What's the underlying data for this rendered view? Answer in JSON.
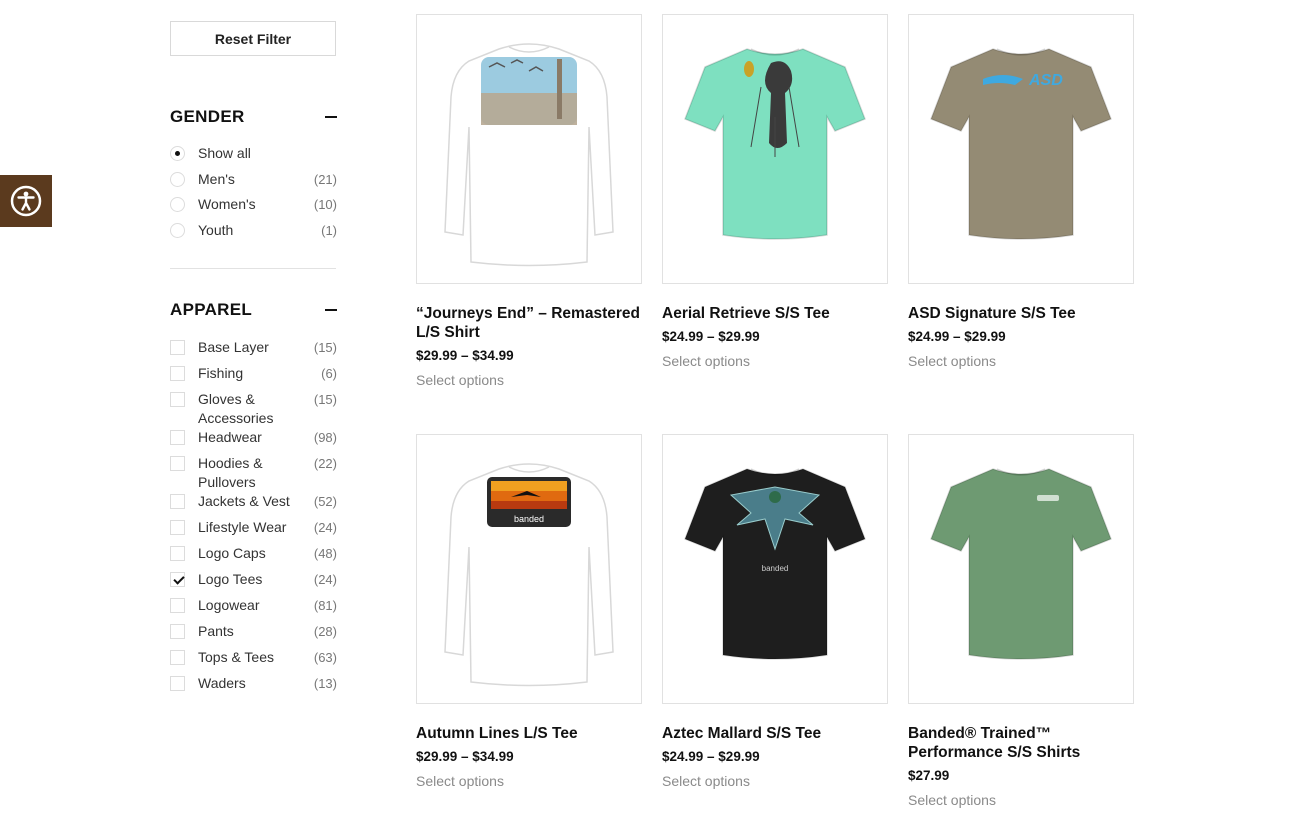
{
  "sidebar": {
    "reset_label": "Reset Filter",
    "gender": {
      "title": "GENDER",
      "options": [
        {
          "label": "Show all",
          "count": "",
          "checked": true
        },
        {
          "label": "Men's",
          "count": "(21)",
          "checked": false
        },
        {
          "label": "Women's",
          "count": "(10)",
          "checked": false
        },
        {
          "label": "Youth",
          "count": "(1)",
          "checked": false
        }
      ]
    },
    "apparel": {
      "title": "APPAREL",
      "options": [
        {
          "label": "Base Layer",
          "count": "(15)",
          "checked": false
        },
        {
          "label": "Fishing",
          "count": "(6)",
          "checked": false
        },
        {
          "label": "Gloves & Accessories",
          "count": "(15)",
          "checked": false
        },
        {
          "label": "Headwear",
          "count": "(98)",
          "checked": false
        },
        {
          "label": "Hoodies & Pullovers",
          "count": "(22)",
          "checked": false
        },
        {
          "label": "Jackets & Vest",
          "count": "(52)",
          "checked": false
        },
        {
          "label": "Lifestyle Wear",
          "count": "(24)",
          "checked": false
        },
        {
          "label": "Logo Caps",
          "count": "(48)",
          "checked": false
        },
        {
          "label": "Logo Tees",
          "count": "(24)",
          "checked": true
        },
        {
          "label": "Logowear",
          "count": "(81)",
          "checked": false
        },
        {
          "label": "Pants",
          "count": "(28)",
          "checked": false
        },
        {
          "label": "Tops & Tees",
          "count": "(63)",
          "checked": false
        },
        {
          "label": "Waders",
          "count": "(13)",
          "checked": false
        }
      ]
    }
  },
  "products": [
    {
      "name": "“Journeys End” – Remastered L/S Shirt",
      "price": "$29.99 – $34.99",
      "action": "Select options",
      "shirt_color": "#ffffff",
      "sleeves": "long",
      "print": "back-scene"
    },
    {
      "name": "Aerial Retrieve S/S Tee",
      "price": "$24.99 – $29.99",
      "action": "Select options",
      "shirt_color": "#7ee0c0",
      "sleeves": "short",
      "print": "dog"
    },
    {
      "name": "ASD Signature S/S Tee",
      "price": "$24.99 – $29.99",
      "action": "Select options",
      "shirt_color": "#948b74",
      "sleeves": "short",
      "print": "logo"
    },
    {
      "name": "Autumn Lines L/S Tee",
      "price": "$29.99 – $34.99",
      "action": "Select options",
      "shirt_color": "#ffffff",
      "sleeves": "long",
      "print": "sunset-patch"
    },
    {
      "name": "Aztec Mallard S/S Tee",
      "price": "$24.99 – $29.99",
      "action": "Select options",
      "shirt_color": "#1e1e1e",
      "sleeves": "short",
      "print": "mallard"
    },
    {
      "name": "Banded® Trained™ Performance S/S Shirts",
      "price": "$27.99",
      "action": "Select options",
      "shirt_color": "#6e9a72",
      "sleeves": "short",
      "print": "small-logo"
    }
  ]
}
